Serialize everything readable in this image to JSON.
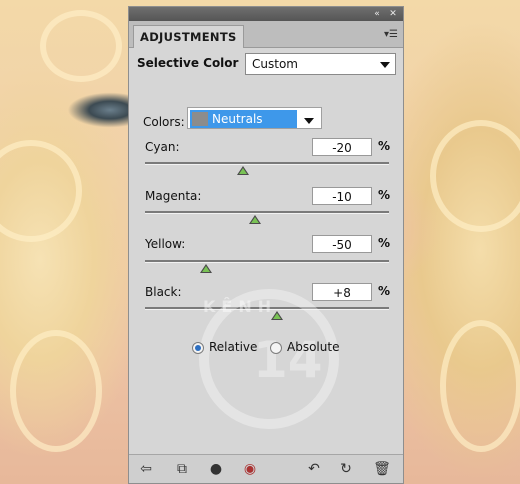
{
  "panel": {
    "tab_title": "ADJUSTMENTS",
    "collapse_icon": "double-chevron-left-icon",
    "close_icon": "close-icon",
    "menu_icon": "panel-menu-icon"
  },
  "selective_color": {
    "label": "Selective Color",
    "preset_value": "Custom",
    "colors_label": "Colors:",
    "colors_value": "Neutrals"
  },
  "sliders": [
    {
      "label": "Cyan:",
      "value": "-20",
      "unit": "%",
      "level": 0.4
    },
    {
      "label": "Magenta:",
      "value": "-10",
      "unit": "%",
      "level": 0.45
    },
    {
      "label": "Yellow:",
      "value": "-50",
      "unit": "%",
      "level": 0.25
    },
    {
      "label": "Black:",
      "value": "+8",
      "unit": "%",
      "level": 0.54
    }
  ],
  "method": {
    "relative_label": "Relative",
    "absolute_label": "Absolute",
    "selected": "Relative"
  },
  "watermark": {
    "top_text": "KÊNH",
    "number": "14"
  },
  "bottom_icons": [
    "back-arrow-icon",
    "expand-view-icon",
    "clip-layer-icon",
    "visibility-eye-icon",
    "previous-state-icon",
    "reset-icon",
    "trash-icon"
  ],
  "colors": {
    "swatch": "#3e98ea",
    "thumb": "#79c255",
    "panel_bg": "#d6d6d6"
  }
}
